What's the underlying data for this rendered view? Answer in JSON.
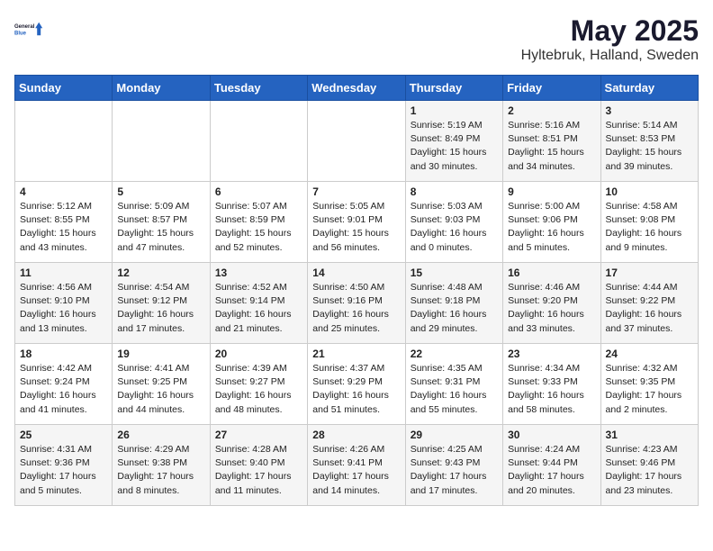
{
  "logo": {
    "line1": "General",
    "line2": "Blue"
  },
  "title": "May 2025",
  "subtitle": "Hyltebruk, Halland, Sweden",
  "days_of_week": [
    "Sunday",
    "Monday",
    "Tuesday",
    "Wednesday",
    "Thursday",
    "Friday",
    "Saturday"
  ],
  "weeks": [
    [
      {
        "day": "",
        "info": ""
      },
      {
        "day": "",
        "info": ""
      },
      {
        "day": "",
        "info": ""
      },
      {
        "day": "",
        "info": ""
      },
      {
        "day": "1",
        "info": "Sunrise: 5:19 AM\nSunset: 8:49 PM\nDaylight: 15 hours\nand 30 minutes."
      },
      {
        "day": "2",
        "info": "Sunrise: 5:16 AM\nSunset: 8:51 PM\nDaylight: 15 hours\nand 34 minutes."
      },
      {
        "day": "3",
        "info": "Sunrise: 5:14 AM\nSunset: 8:53 PM\nDaylight: 15 hours\nand 39 minutes."
      }
    ],
    [
      {
        "day": "4",
        "info": "Sunrise: 5:12 AM\nSunset: 8:55 PM\nDaylight: 15 hours\nand 43 minutes."
      },
      {
        "day": "5",
        "info": "Sunrise: 5:09 AM\nSunset: 8:57 PM\nDaylight: 15 hours\nand 47 minutes."
      },
      {
        "day": "6",
        "info": "Sunrise: 5:07 AM\nSunset: 8:59 PM\nDaylight: 15 hours\nand 52 minutes."
      },
      {
        "day": "7",
        "info": "Sunrise: 5:05 AM\nSunset: 9:01 PM\nDaylight: 15 hours\nand 56 minutes."
      },
      {
        "day": "8",
        "info": "Sunrise: 5:03 AM\nSunset: 9:03 PM\nDaylight: 16 hours\nand 0 minutes."
      },
      {
        "day": "9",
        "info": "Sunrise: 5:00 AM\nSunset: 9:06 PM\nDaylight: 16 hours\nand 5 minutes."
      },
      {
        "day": "10",
        "info": "Sunrise: 4:58 AM\nSunset: 9:08 PM\nDaylight: 16 hours\nand 9 minutes."
      }
    ],
    [
      {
        "day": "11",
        "info": "Sunrise: 4:56 AM\nSunset: 9:10 PM\nDaylight: 16 hours\nand 13 minutes."
      },
      {
        "day": "12",
        "info": "Sunrise: 4:54 AM\nSunset: 9:12 PM\nDaylight: 16 hours\nand 17 minutes."
      },
      {
        "day": "13",
        "info": "Sunrise: 4:52 AM\nSunset: 9:14 PM\nDaylight: 16 hours\nand 21 minutes."
      },
      {
        "day": "14",
        "info": "Sunrise: 4:50 AM\nSunset: 9:16 PM\nDaylight: 16 hours\nand 25 minutes."
      },
      {
        "day": "15",
        "info": "Sunrise: 4:48 AM\nSunset: 9:18 PM\nDaylight: 16 hours\nand 29 minutes."
      },
      {
        "day": "16",
        "info": "Sunrise: 4:46 AM\nSunset: 9:20 PM\nDaylight: 16 hours\nand 33 minutes."
      },
      {
        "day": "17",
        "info": "Sunrise: 4:44 AM\nSunset: 9:22 PM\nDaylight: 16 hours\nand 37 minutes."
      }
    ],
    [
      {
        "day": "18",
        "info": "Sunrise: 4:42 AM\nSunset: 9:24 PM\nDaylight: 16 hours\nand 41 minutes."
      },
      {
        "day": "19",
        "info": "Sunrise: 4:41 AM\nSunset: 9:25 PM\nDaylight: 16 hours\nand 44 minutes."
      },
      {
        "day": "20",
        "info": "Sunrise: 4:39 AM\nSunset: 9:27 PM\nDaylight: 16 hours\nand 48 minutes."
      },
      {
        "day": "21",
        "info": "Sunrise: 4:37 AM\nSunset: 9:29 PM\nDaylight: 16 hours\nand 51 minutes."
      },
      {
        "day": "22",
        "info": "Sunrise: 4:35 AM\nSunset: 9:31 PM\nDaylight: 16 hours\nand 55 minutes."
      },
      {
        "day": "23",
        "info": "Sunrise: 4:34 AM\nSunset: 9:33 PM\nDaylight: 16 hours\nand 58 minutes."
      },
      {
        "day": "24",
        "info": "Sunrise: 4:32 AM\nSunset: 9:35 PM\nDaylight: 17 hours\nand 2 minutes."
      }
    ],
    [
      {
        "day": "25",
        "info": "Sunrise: 4:31 AM\nSunset: 9:36 PM\nDaylight: 17 hours\nand 5 minutes."
      },
      {
        "day": "26",
        "info": "Sunrise: 4:29 AM\nSunset: 9:38 PM\nDaylight: 17 hours\nand 8 minutes."
      },
      {
        "day": "27",
        "info": "Sunrise: 4:28 AM\nSunset: 9:40 PM\nDaylight: 17 hours\nand 11 minutes."
      },
      {
        "day": "28",
        "info": "Sunrise: 4:26 AM\nSunset: 9:41 PM\nDaylight: 17 hours\nand 14 minutes."
      },
      {
        "day": "29",
        "info": "Sunrise: 4:25 AM\nSunset: 9:43 PM\nDaylight: 17 hours\nand 17 minutes."
      },
      {
        "day": "30",
        "info": "Sunrise: 4:24 AM\nSunset: 9:44 PM\nDaylight: 17 hours\nand 20 minutes."
      },
      {
        "day": "31",
        "info": "Sunrise: 4:23 AM\nSunset: 9:46 PM\nDaylight: 17 hours\nand 23 minutes."
      }
    ]
  ]
}
